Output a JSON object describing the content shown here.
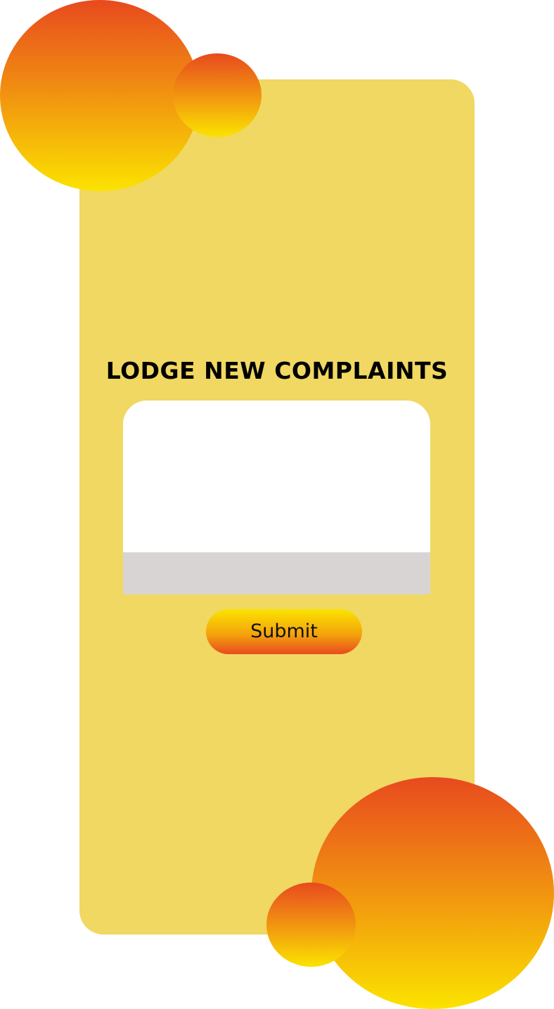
{
  "form": {
    "title": "LODGE NEW COMPLAINTS",
    "complaint_value": "",
    "submit_label": "Submit"
  },
  "colors": {
    "card_background": "#f0d862",
    "field_background": "#ffffff",
    "field_footer": "#d9d4d4",
    "gradient_red": "#e84a1e",
    "gradient_orange": "#f08c12",
    "gradient_yellow": "#fbe300",
    "text": "#000000"
  }
}
